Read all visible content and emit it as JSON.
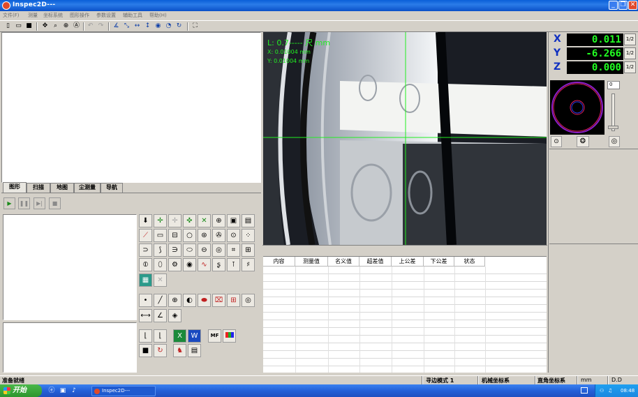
{
  "window": {
    "title": "Inspec2D---"
  },
  "menu": [
    "文件(F)",
    "测量",
    "坐标系统",
    "图形操作",
    "参数设置",
    "辅助工具",
    "帮助(H)"
  ],
  "toolbar": {
    "file": [
      "new-file-icon",
      "open-file-icon",
      "save-file-icon"
    ],
    "view": [
      "pan-icon",
      "zoom-window-icon",
      "zoom-all-icon",
      "zoom-a-icon"
    ],
    "edit": [
      "undo-icon",
      "redo-icon"
    ],
    "measure": [
      "angle-icon",
      "distance-icon",
      "horizontal-distance-icon",
      "vertical-distance-icon",
      "circle-tool-icon",
      "arc-tool-icon",
      "rotate-icon"
    ],
    "extra": [
      "crop-icon"
    ]
  },
  "tabs": [
    "图形",
    "扫描",
    "地图",
    "尘测量",
    "导航"
  ],
  "playback": [
    "play-icon",
    "pause-icon",
    "step-icon",
    "stop-icon"
  ],
  "camera": {
    "line1": "L: 0.7----- 尺 mm",
    "line2": "X: 0.01004 mm",
    "line3": "Y: 0.01004 mm"
  },
  "table": {
    "headers": [
      "内容",
      "测量值",
      "名义值",
      "超差值",
      "上公差",
      "下公差",
      "状态"
    ]
  },
  "dro": {
    "axes": [
      {
        "label": "X",
        "value": "0.011",
        "half": "1/2"
      },
      {
        "label": "Y",
        "value": "-6.266",
        "half": "1/2"
      },
      {
        "label": "Z",
        "value": "0.000",
        "half": "1/2"
      }
    ],
    "slider_value": "0"
  },
  "statusbar": {
    "ready": "准备就绪",
    "mode": "寻边模式 1",
    "machine": "机械坐标系",
    "cartesian": "直角坐标系",
    "unit": "mm",
    "format": "D.D"
  },
  "taskbar": {
    "start": "开始",
    "item": "Inspec2D---",
    "time": "08:48"
  },
  "colors": {
    "accent": "#0a5fd8",
    "dro_text": "#22ff22",
    "crosshair": "#22ee22"
  }
}
